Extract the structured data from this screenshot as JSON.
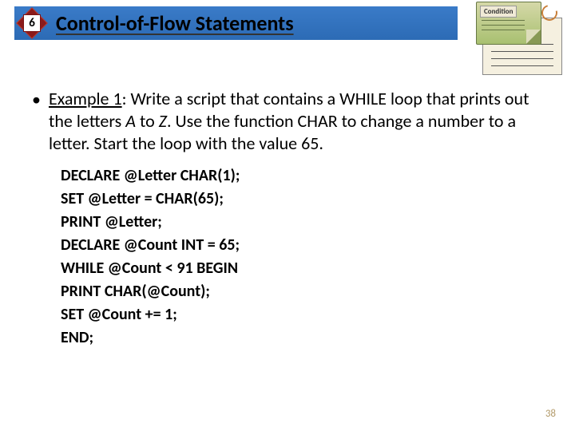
{
  "header": {
    "badge_number": "6",
    "title": "Control-of-Flow Statements"
  },
  "decoration": {
    "note_label": "Condition"
  },
  "content": {
    "example_label": "Example 1",
    "example_text_1": ": Write a script that contains a WHILE loop that prints out the letters ",
    "example_italic_1": "A",
    "example_text_2": " to ",
    "example_italic_2": "Z",
    "example_text_3": ". Use the function CHAR to change a number to a letter. Start the loop with the value 65."
  },
  "code": [
    "DECLARE @Letter CHAR(1);",
    "SET @Letter = CHAR(65);",
    "PRINT @Letter;",
    "DECLARE @Count INT = 65;",
    "WHILE @Count < 91 BEGIN",
    "PRINT CHAR(@Count);",
    "SET @Count += 1;",
    "END;"
  ],
  "page_number": "38"
}
